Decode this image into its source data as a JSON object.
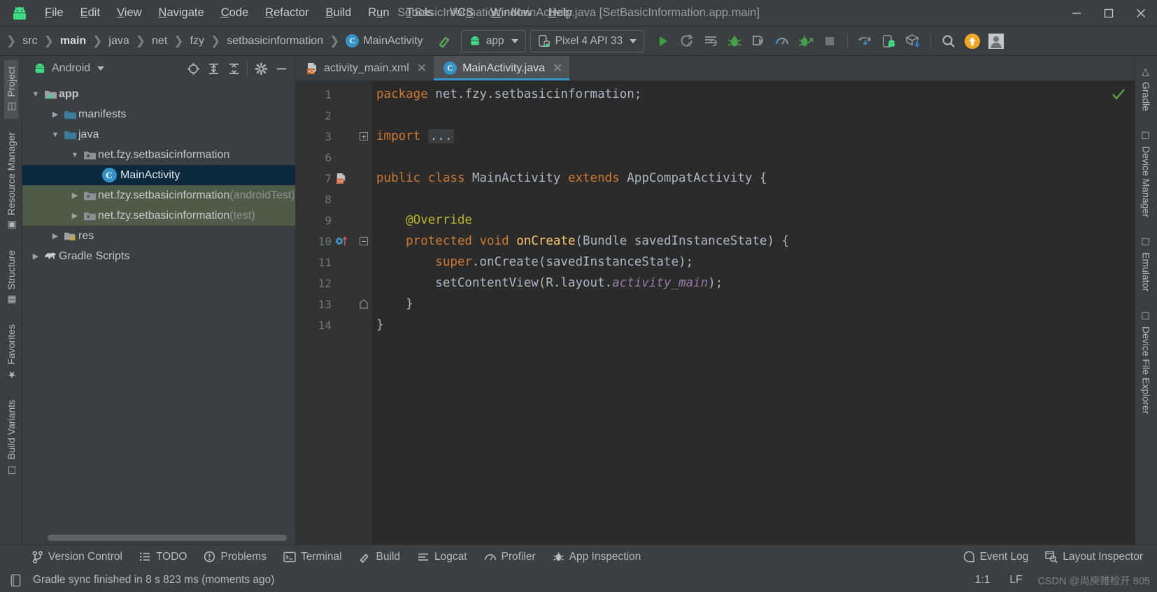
{
  "window": {
    "title": "SetBasicInformation - MainActivity.java [SetBasicInformation.app.main]",
    "minimize_label": "─",
    "maximize_label": "☐",
    "close_label": "✕",
    "logo_icon": "android-logo-icon"
  },
  "menu": [
    {
      "pre": "",
      "mn": "F",
      "post": "ile",
      "name": "menu-file"
    },
    {
      "pre": "",
      "mn": "E",
      "post": "dit",
      "name": "menu-edit"
    },
    {
      "pre": "",
      "mn": "V",
      "post": "iew",
      "name": "menu-view"
    },
    {
      "pre": "",
      "mn": "N",
      "post": "avigate",
      "name": "menu-navigate"
    },
    {
      "pre": "",
      "mn": "C",
      "post": "ode",
      "name": "menu-code"
    },
    {
      "pre": "",
      "mn": "R",
      "post": "efactor",
      "name": "menu-refactor"
    },
    {
      "pre": "",
      "mn": "B",
      "post": "uild",
      "name": "menu-build"
    },
    {
      "pre": "R",
      "mn": "u",
      "post": "n",
      "name": "menu-run"
    },
    {
      "pre": "",
      "mn": "T",
      "post": "ools",
      "name": "menu-tools"
    },
    {
      "pre": "VC",
      "mn": "S",
      "post": "",
      "name": "menu-vcs"
    },
    {
      "pre": "",
      "mn": "W",
      "post": "indow",
      "name": "menu-window"
    },
    {
      "pre": "",
      "mn": "H",
      "post": "elp",
      "name": "menu-help"
    }
  ],
  "breadcrumb": [
    {
      "label": "src",
      "bold": false,
      "badge": false
    },
    {
      "label": "main",
      "bold": true,
      "badge": false
    },
    {
      "label": "java",
      "bold": false,
      "badge": false
    },
    {
      "label": "net",
      "bold": false,
      "badge": false
    },
    {
      "label": "fzy",
      "bold": false,
      "badge": false
    },
    {
      "label": "setbasicinformation",
      "bold": false,
      "badge": false
    },
    {
      "label": "MainActivity",
      "bold": false,
      "badge": true,
      "badge_letter": "C"
    }
  ],
  "toolbar": {
    "build_hammer_icon": "hammer-icon",
    "run_config_label": "app",
    "run_config_icon": "android-icon",
    "device_label": "Pixel 4 API 33",
    "device_icon": "device-phone-icon",
    "actions": [
      {
        "name": "run-button",
        "icon": "play-icon"
      },
      {
        "name": "apply-changes-button",
        "icon": "apply-code-changes-icon"
      },
      {
        "name": "apply-changes-restart-button",
        "icon": "apply-changes-restart-icon"
      },
      {
        "name": "debug-button",
        "icon": "bug-icon"
      },
      {
        "name": "attach-debugger-button",
        "icon": "attach-debugger-icon"
      },
      {
        "name": "profile-button",
        "icon": "profiler-gauge-icon"
      },
      {
        "name": "run-with-coverage-button",
        "icon": "coverage-icon"
      },
      {
        "name": "stop-button",
        "icon": "stop-square-icon"
      },
      {
        "name": "sync-gradle-button",
        "icon": "gradle-sync-icon"
      },
      {
        "name": "avd-manager-button",
        "icon": "avd-manager-icon"
      },
      {
        "name": "sdk-manager-button",
        "icon": "sdk-manager-icon"
      },
      {
        "name": "search-everywhere-button",
        "icon": "search-icon"
      },
      {
        "name": "update-button",
        "icon": "update-arrow-icon"
      },
      {
        "name": "account-button",
        "icon": "avatar-icon"
      }
    ]
  },
  "project_panel": {
    "title": "Android",
    "title_icon": "android-icon",
    "actions": [
      {
        "name": "select-opened-file-button",
        "icon": "crosshair-target-icon"
      },
      {
        "name": "expand-all-button",
        "icon": "expand-all-icon"
      },
      {
        "name": "collapse-all-button",
        "icon": "collapse-all-icon"
      },
      {
        "name": "panel-settings-button",
        "icon": "gear-icon"
      },
      {
        "name": "hide-panel-button",
        "icon": "minimize-icon"
      }
    ],
    "tree": [
      {
        "label": "app",
        "suffix": "",
        "indent": 0,
        "arrow": "down",
        "icon": "module-folder-icon",
        "bold": true,
        "state": "normal"
      },
      {
        "label": "manifests",
        "suffix": "",
        "indent": 1,
        "arrow": "right",
        "icon": "folder-icon",
        "bold": false,
        "state": "normal"
      },
      {
        "label": "java",
        "suffix": "",
        "indent": 1,
        "arrow": "down",
        "icon": "folder-icon",
        "bold": false,
        "state": "normal"
      },
      {
        "label": "net.fzy.setbasicinformation",
        "suffix": "",
        "indent": 2,
        "arrow": "down",
        "icon": "package-icon",
        "bold": false,
        "state": "normal"
      },
      {
        "label": "MainActivity",
        "suffix": "",
        "indent": 3,
        "arrow": "none",
        "icon": "java-class-icon",
        "bold": false,
        "state": "selected"
      },
      {
        "label": "net.fzy.setbasicinformation",
        "suffix": " (androidTest)",
        "indent": 2,
        "arrow": "right",
        "icon": "package-icon",
        "bold": false,
        "state": "test"
      },
      {
        "label": "net.fzy.setbasicinformation",
        "suffix": " (test)",
        "indent": 2,
        "arrow": "right",
        "icon": "package-icon",
        "bold": false,
        "state": "test"
      },
      {
        "label": "res",
        "suffix": "",
        "indent": 1,
        "arrow": "right",
        "icon": "res-folder-icon",
        "bold": false,
        "state": "normal"
      },
      {
        "label": "Gradle Scripts",
        "suffix": "",
        "indent": 0,
        "arrow": "right",
        "icon": "gradle-elephant-icon",
        "bold": false,
        "state": "normal"
      }
    ]
  },
  "left_tool_strip": [
    {
      "label": "Project",
      "icon": "project-icon",
      "active": true,
      "name": "tool-window-project"
    },
    {
      "label": "Resource Manager",
      "icon": "resource-manager-icon",
      "active": false,
      "name": "tool-window-resource-manager"
    },
    {
      "label": "Structure",
      "icon": "structure-icon",
      "active": false,
      "name": "tool-window-structure"
    },
    {
      "label": "Favorites",
      "icon": "star-icon",
      "active": false,
      "name": "tool-window-favorites"
    },
    {
      "label": "Build Variants",
      "icon": "build-variants-icon",
      "active": false,
      "name": "tool-window-build-variants"
    }
  ],
  "right_tool_strip": [
    {
      "label": "Gradle",
      "icon": "gradle-elephant-icon",
      "name": "tool-window-gradle"
    },
    {
      "label": "Device Manager",
      "icon": "device-manager-icon",
      "name": "tool-window-device-manager"
    },
    {
      "label": "Emulator",
      "icon": "emulator-icon",
      "name": "tool-window-emulator"
    },
    {
      "label": "Device File Explorer",
      "icon": "device-file-explorer-icon",
      "name": "tool-window-device-file-explorer"
    }
  ],
  "editor": {
    "tabs": [
      {
        "label": "activity_main.xml",
        "icon": "xml-layout-icon",
        "active": false,
        "closable": true
      },
      {
        "label": "MainActivity.java",
        "icon": "java-class-icon",
        "active": true,
        "closable": true
      }
    ],
    "inspection_status_icon": "checkmark-ok-icon",
    "lines": [
      {
        "num": "1",
        "gutter": "",
        "fold": "",
        "tokens": [
          {
            "t": "package ",
            "c": "k"
          },
          {
            "t": "net.fzy.setbasicinformation",
            "c": "id"
          },
          {
            "t": ";",
            "c": "pun"
          }
        ]
      },
      {
        "num": "2",
        "gutter": "",
        "fold": "",
        "tokens": []
      },
      {
        "num": "3",
        "gutter": "",
        "fold": "plus",
        "tokens": [
          {
            "t": "import ",
            "c": "k"
          },
          {
            "t": "...",
            "c": "folded"
          }
        ]
      },
      {
        "num": "6",
        "gutter": "",
        "fold": "",
        "tokens": []
      },
      {
        "num": "7",
        "gutter": "layout-file-icon",
        "fold": "",
        "tokens": [
          {
            "t": "public ",
            "c": "k"
          },
          {
            "t": "class ",
            "c": "k"
          },
          {
            "t": "MainActivity ",
            "c": "id"
          },
          {
            "t": "extends ",
            "c": "k"
          },
          {
            "t": "AppCompatActivity",
            "c": "id"
          },
          {
            "t": " {",
            "c": "pun"
          }
        ]
      },
      {
        "num": "8",
        "gutter": "",
        "fold": "",
        "tokens": []
      },
      {
        "num": "9",
        "gutter": "",
        "fold": "",
        "tokens": [
          {
            "t": "    @Override",
            "c": "ann"
          }
        ]
      },
      {
        "num": "10",
        "gutter": "override-method-icon",
        "fold": "minus",
        "tokens": [
          {
            "t": "    protected ",
            "c": "k"
          },
          {
            "t": "void ",
            "c": "k"
          },
          {
            "t": "onCreate",
            "c": "fn"
          },
          {
            "t": "(",
            "c": "pun"
          },
          {
            "t": "Bundle savedInstanceState",
            "c": "id"
          },
          {
            "t": ") {",
            "c": "pun"
          }
        ]
      },
      {
        "num": "11",
        "gutter": "",
        "fold": "",
        "tokens": [
          {
            "t": "        super",
            "c": "k"
          },
          {
            "t": ".onCreate(savedInstanceState)",
            "c": "id"
          },
          {
            "t": ";",
            "c": "pun"
          }
        ]
      },
      {
        "num": "12",
        "gutter": "",
        "fold": "",
        "tokens": [
          {
            "t": "        setContentView(R.layout.",
            "c": "id"
          },
          {
            "t": "activity_main",
            "c": "stat"
          },
          {
            "t": ")",
            "c": "id"
          },
          {
            "t": ";",
            "c": "pun"
          }
        ]
      },
      {
        "num": "13",
        "gutter": "",
        "fold": "endfold",
        "tokens": [
          {
            "t": "    }",
            "c": "pun"
          }
        ]
      },
      {
        "num": "14",
        "gutter": "",
        "fold": "",
        "tokens": [
          {
            "t": "}",
            "c": "pun"
          }
        ]
      }
    ]
  },
  "bottom_tabs": [
    {
      "label": "Version Control",
      "icon": "branch-icon",
      "name": "bottom-tab-version-control"
    },
    {
      "label": "TODO",
      "icon": "todo-list-icon",
      "name": "bottom-tab-todo"
    },
    {
      "label": "Problems",
      "icon": "problems-warning-icon",
      "name": "bottom-tab-problems"
    },
    {
      "label": "Terminal",
      "icon": "terminal-icon",
      "name": "bottom-tab-terminal"
    },
    {
      "label": "Build",
      "icon": "hammer-icon",
      "name": "bottom-tab-build"
    },
    {
      "label": "Logcat",
      "icon": "logcat-icon",
      "name": "bottom-tab-logcat"
    },
    {
      "label": "Profiler",
      "icon": "profiler-gauge-icon",
      "name": "bottom-tab-profiler"
    },
    {
      "label": "App Inspection",
      "icon": "app-inspection-icon",
      "name": "bottom-tab-app-inspection"
    }
  ],
  "bottom_tabs_right": [
    {
      "label": "Event Log",
      "icon": "event-log-icon",
      "name": "bottom-tab-event-log"
    },
    {
      "label": "Layout Inspector",
      "icon": "layout-inspector-icon",
      "name": "bottom-tab-layout-inspector"
    }
  ],
  "status_bar": {
    "message_icon": "status-file-icon",
    "message": "Gradle sync finished in 8 s 823 ms (moments ago)",
    "caret_position": "1:1",
    "line_separator": "LF",
    "watermark": "CSDN @尚庾雑检开 805"
  },
  "colors": {
    "accent_blue": "#3592c4",
    "keyword_orange": "#cc7832",
    "method_yellow": "#ffc66d",
    "annotation_yellow": "#bbb529",
    "static_purple": "#9876aa",
    "identifier": "#a9b7c6",
    "editor_bg": "#2b2b2b",
    "chrome_bg": "#3c3f41",
    "selection_blue": "#0d293e",
    "test_green": "#4e5b47",
    "android_green": "#3ddc84",
    "warning_orange": "#f5a623"
  }
}
